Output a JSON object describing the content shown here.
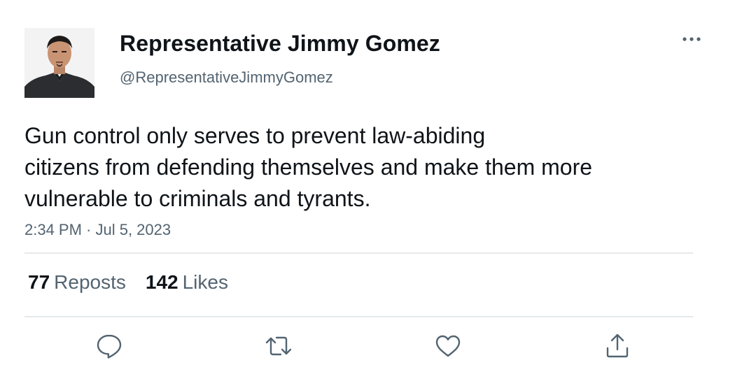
{
  "tweet": {
    "author": {
      "display_name": "Representative Jimmy Gomez",
      "handle": "@RepresentativeJimmyGomez",
      "avatar_icon": "profile-photo"
    },
    "more_icon": "more-horizontal-icon",
    "text": "Gun control only serves to prevent law-abiding\ncitizens from defending themselves and make them more\nvulnerable to criminals and tyrants.",
    "timestamp": "2:34 PM · Jul 5, 2023",
    "stats": {
      "reposts_count": "77",
      "reposts_label": "Reposts",
      "likes_count": "142",
      "likes_label": "Likes"
    },
    "actions": [
      {
        "name": "reply",
        "icon": "reply-icon"
      },
      {
        "name": "repost",
        "icon": "repost-icon"
      },
      {
        "name": "like",
        "icon": "heart-icon"
      },
      {
        "name": "share",
        "icon": "share-icon"
      }
    ],
    "colors": {
      "text": "#0f1419",
      "secondary": "#536471",
      "divider": "#e6e9eb"
    }
  }
}
